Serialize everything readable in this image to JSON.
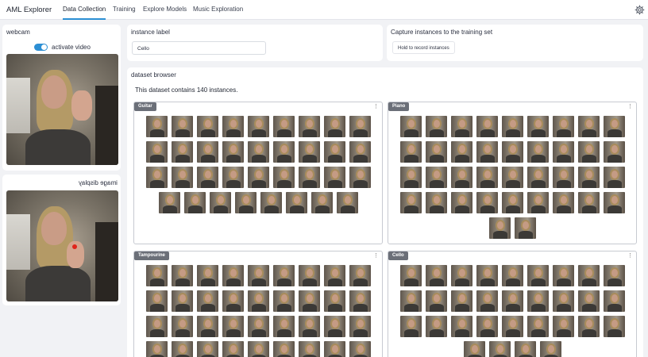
{
  "header": {
    "app_title": "AML Explorer",
    "tabs": [
      {
        "label": "Data Collection",
        "active": true
      },
      {
        "label": "Training",
        "active": false
      },
      {
        "label": "Explore Models",
        "active": false
      },
      {
        "label": "Music Exploration",
        "active": false
      }
    ],
    "settings_icon": "gear-icon"
  },
  "webcam": {
    "title": "webcam",
    "toggle_label": "activate video",
    "toggle_on": true
  },
  "image_display": {
    "title": "image display",
    "mirrored": true
  },
  "instance_label": {
    "title": "instance label",
    "value": "Cello"
  },
  "capture": {
    "title": "Capture instances to the training set",
    "button_label": "Hold to record instances"
  },
  "dataset_browser": {
    "title": "dataset browser",
    "summary": "This dataset contains 140 instances.",
    "classes": [
      {
        "label": "Guitar",
        "instances": 35
      },
      {
        "label": "Piano",
        "instances": 38
      },
      {
        "label": "Tampourine",
        "instances": 36
      },
      {
        "label": "Cello",
        "instances": 31
      }
    ],
    "menu_icon": "kebab-menu-icon"
  },
  "colors": {
    "accent": "#2c8fd4",
    "background": "#f1f2f5",
    "tag": "#6b6f78"
  }
}
